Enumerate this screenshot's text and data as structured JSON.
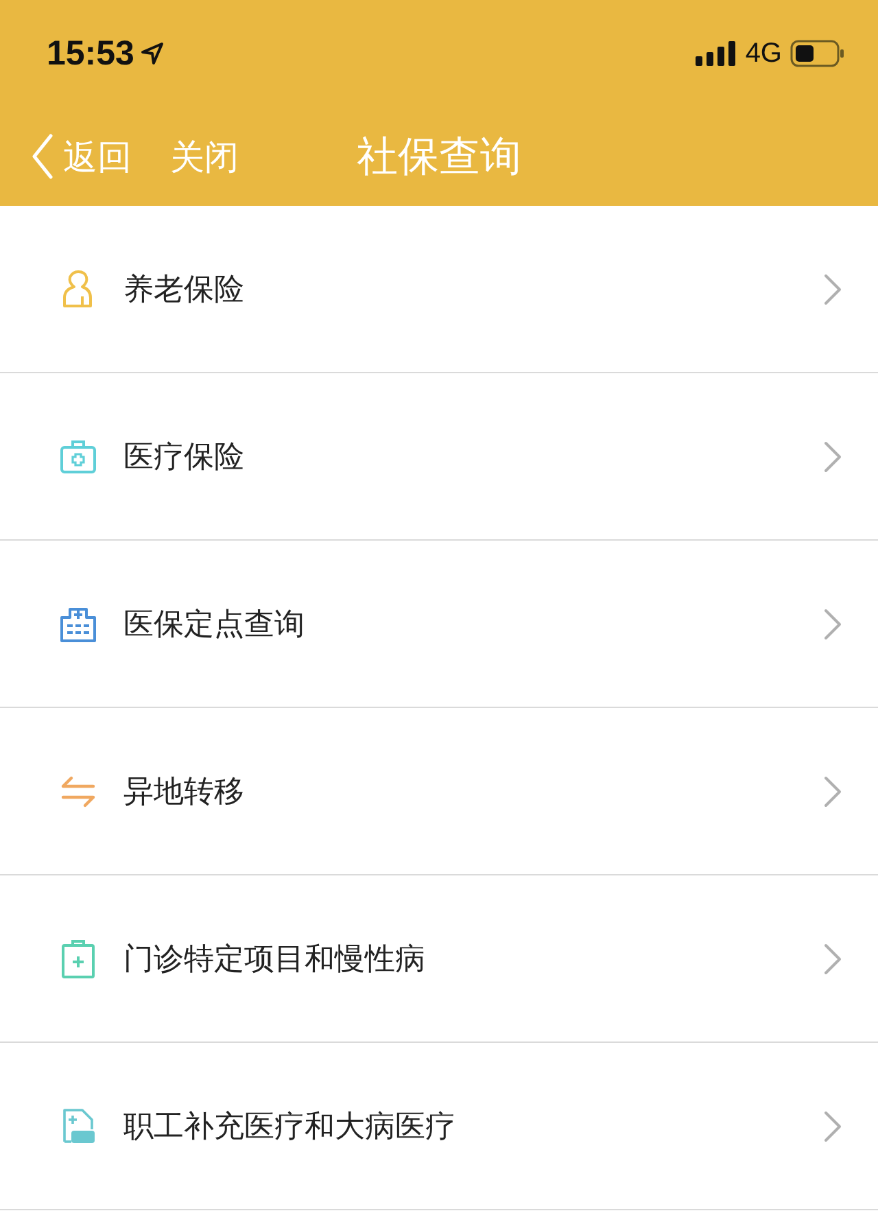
{
  "status_bar": {
    "time": "15:53",
    "network": "4G"
  },
  "nav_bar": {
    "back": "返回",
    "close": "关闭",
    "title": "社保查询"
  },
  "menu": [
    {
      "label": "养老保险",
      "kind": "person",
      "color": "#f0c04a"
    },
    {
      "label": "医疗保险",
      "kind": "medkit",
      "color": "#5fcfd8"
    },
    {
      "label": "医保定点查询",
      "kind": "hospital",
      "color": "#4a8fd8"
    },
    {
      "label": "异地转移",
      "kind": "transfer",
      "color": "#f0a860"
    },
    {
      "label": "门诊特定项目和慢性病",
      "kind": "clipboard",
      "color": "#5ad0b0"
    },
    {
      "label": "职工补充医疗和大病医疗",
      "kind": "document",
      "color": "#6ac8d0"
    }
  ]
}
